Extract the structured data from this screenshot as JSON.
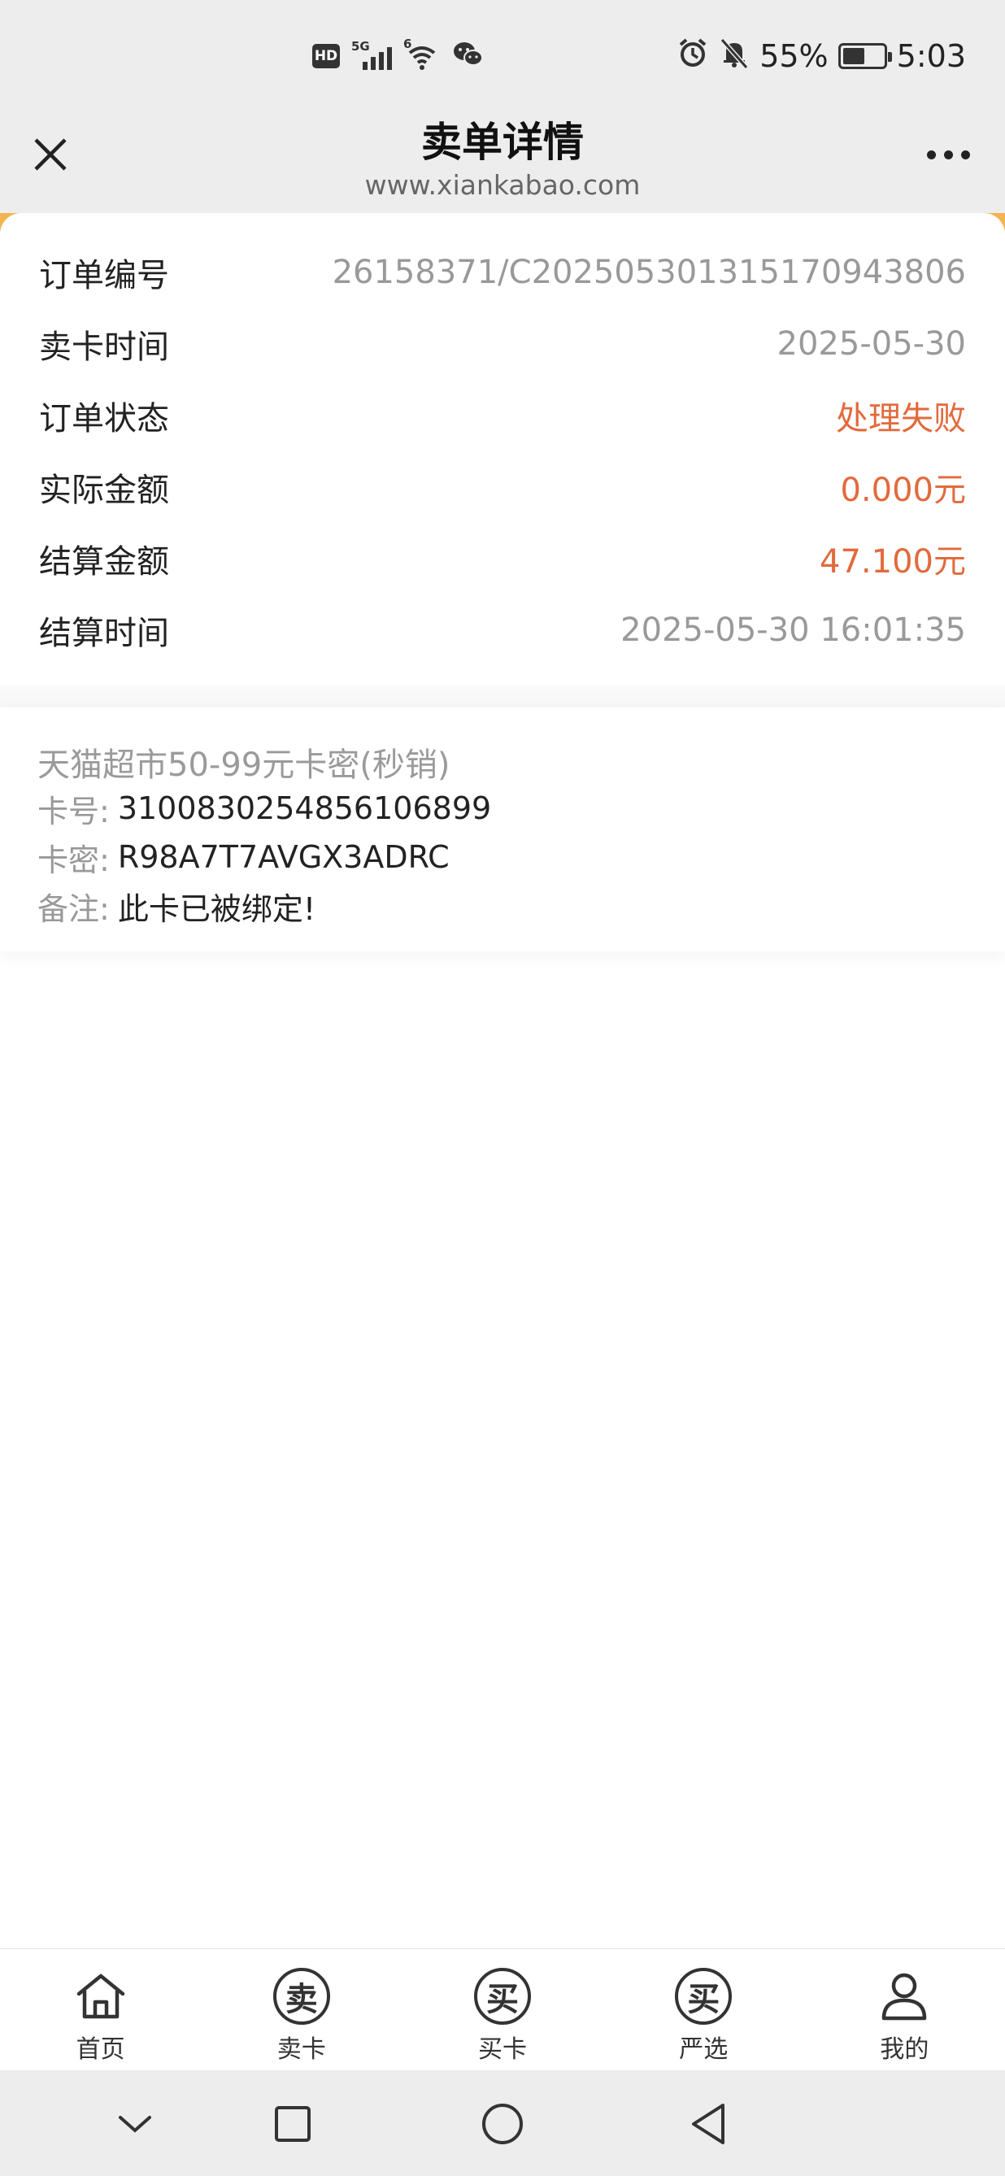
{
  "status_bar": {
    "hd": "HD",
    "network": "5G",
    "wifi_tag": "6",
    "battery": "55%",
    "time": "5:03"
  },
  "header": {
    "title": "卖单详情",
    "url": "www.xiankabao.com"
  },
  "order": {
    "rows": [
      {
        "label": "订单编号",
        "value": "26158371/C2025053013151709438​06"
      },
      {
        "label": "卖卡时间",
        "value": "2025-05-30"
      },
      {
        "label": "订单状态",
        "value": "处理失败"
      },
      {
        "label": "实际金额",
        "value": "0.000元"
      },
      {
        "label": "结算金额",
        "value": "47.100元"
      },
      {
        "label": "结算时间",
        "value": "2025-05-30 16:01:35"
      }
    ]
  },
  "card": {
    "title": "天猫超市50-99元卡密(秒销)",
    "number_label": "卡号:",
    "number": "3100830254856106899",
    "secret_label": "卡密:",
    "secret": "R98A7T7AVGX3ADRC",
    "note_label": "备注:",
    "note": "此卡已被绑定!"
  },
  "tabs": [
    {
      "label": "首页",
      "icon": "home-icon"
    },
    {
      "label": "卖卡",
      "icon": "sell-icon",
      "glyph": "卖"
    },
    {
      "label": "买卡",
      "icon": "buy-icon",
      "glyph": "买"
    },
    {
      "label": "严选",
      "icon": "select-icon",
      "glyph": "买"
    },
    {
      "label": "我的",
      "icon": "user-icon"
    }
  ],
  "colors": {
    "accent": "#e26a3d",
    "strip": "#f3b450",
    "bar_bg": "#ededed"
  }
}
